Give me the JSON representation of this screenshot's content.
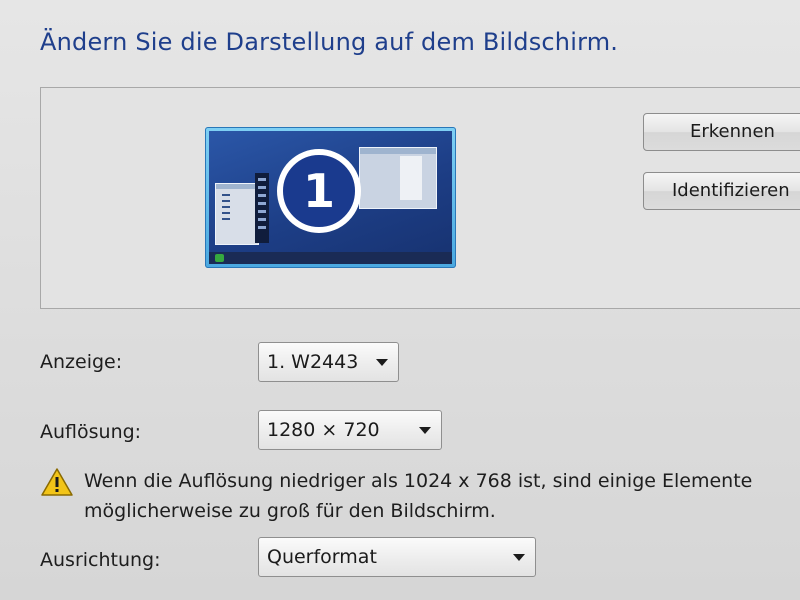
{
  "page": {
    "title": "Ändern Sie die Darstellung auf dem Bildschirm."
  },
  "preview": {
    "monitor_number": "1",
    "detect_button": "Erkennen",
    "identify_button": "Identifizieren"
  },
  "display_field": {
    "label": "Anzeige:",
    "value": "1. W2443"
  },
  "resolution_field": {
    "label": "Auflösung:",
    "value": "1280 × 720"
  },
  "warning": {
    "line1": "Wenn die Auflösung niedriger als 1024 x 768 ist, sind einige Elemente",
    "line2": "möglicherweise zu groß für den Bildschirm."
  },
  "orientation_field": {
    "label": "Ausrichtung:",
    "value": "Querformat"
  },
  "colors": {
    "title": "#1f3f8c",
    "monitor_frame": "#4aa8e0",
    "monitor_badge": "#1a3a8e",
    "warning_icon": "#f2c418"
  },
  "icons": {
    "monitor": "monitor-icon",
    "warning": "warning-icon",
    "dropdown": "chevron-down-icon"
  }
}
